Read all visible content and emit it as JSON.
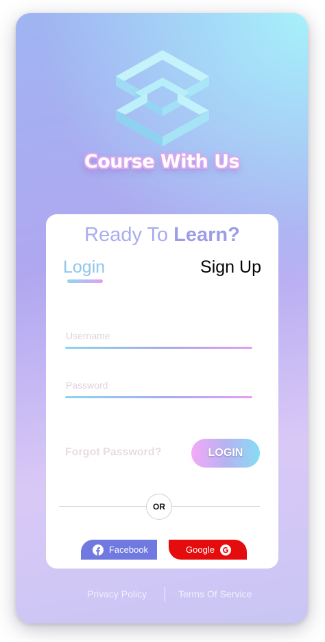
{
  "brand": {
    "name": "Course With Us",
    "logo_icon": "isometric-cube-logo-icon"
  },
  "card": {
    "headline_prefix": "Ready To ",
    "headline_emphasis": "Learn?",
    "tabs": {
      "login": "Login",
      "signup": "Sign Up",
      "active": "login"
    },
    "form": {
      "username_placeholder": "Username",
      "username_value": "",
      "password_placeholder": "Password",
      "password_value": "",
      "forgot_label": "Forgot Password?",
      "login_button": "LOGIN"
    },
    "divider_label": "OR",
    "social": {
      "facebook_label": "Facebook",
      "facebook_icon": "facebook-icon",
      "google_label": "Google",
      "google_icon": "google-icon"
    }
  },
  "footer": {
    "privacy": "Privacy Policy",
    "terms": "Terms Of Service"
  },
  "colors": {
    "accent_blue": "#8dc6ee",
    "accent_purple": "#a9acee",
    "facebook": "#6f79df",
    "google": "#e40c0c"
  }
}
